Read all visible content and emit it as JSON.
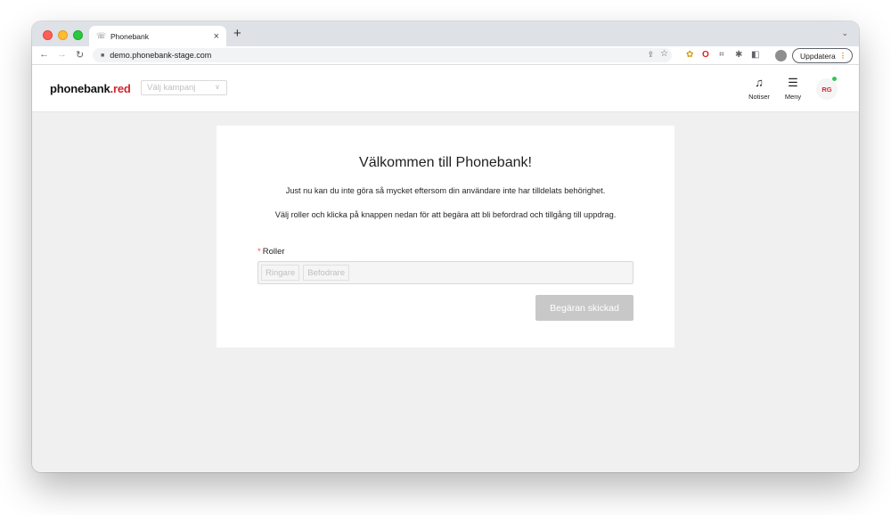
{
  "browser": {
    "tab_title": "Phonebank",
    "url": "demo.phonebank-stage.com",
    "update_label": "Uppdatera"
  },
  "header": {
    "logo_main": "phonebank",
    "logo_accent": ".red",
    "campaign_placeholder": "Välj kampanj",
    "notifications_label": "Notiser",
    "menu_label": "Meny",
    "user_initials": "RG"
  },
  "card": {
    "title": "Välkommen till Phonebank!",
    "description_1": "Just nu kan du inte göra så mycket eftersom din användare inte har tilldelats behörighet.",
    "description_2": "Välj roller och klicka på knappen nedan för att begära att bli befordrad och tillgång till uppdrag.",
    "roles_required_mark": "*",
    "roles_label": "Roller",
    "roles": [
      "Ringare",
      "Befodrare"
    ],
    "submit_label": "Begäran skickad",
    "submit_disabled": true
  },
  "colors": {
    "brand_red": "#d1262e",
    "status_online": "#34c759",
    "disabled_button": "#c8c8c8"
  }
}
